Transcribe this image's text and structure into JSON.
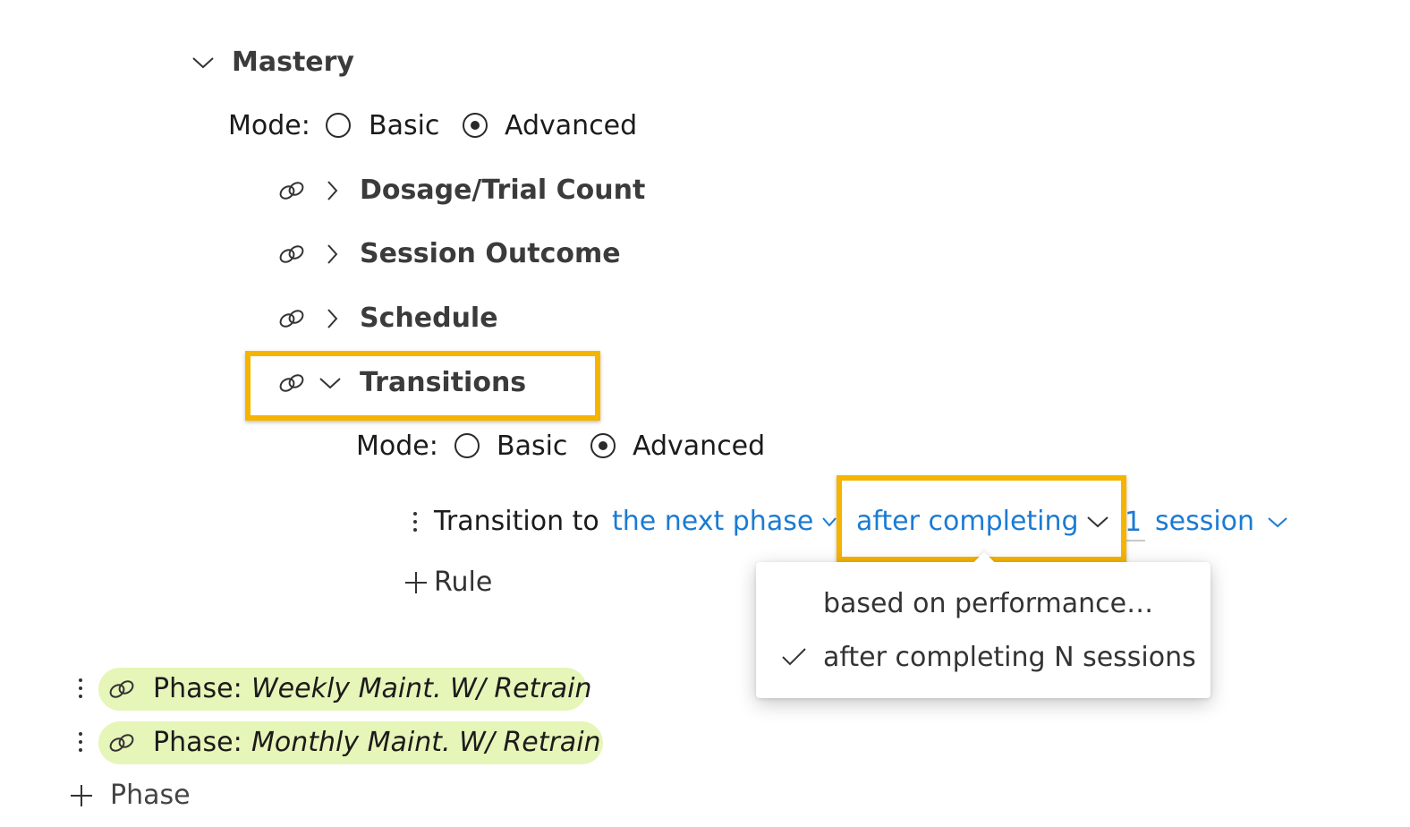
{
  "mastery": {
    "title": "Mastery"
  },
  "mode_top": {
    "label": "Mode:",
    "option_basic": "Basic",
    "option_advanced": "Advanced",
    "selected": "Advanced"
  },
  "sections": [
    {
      "label": "Dosage/Trial Count",
      "expanded": false
    },
    {
      "label": "Session Outcome",
      "expanded": false
    },
    {
      "label": "Schedule",
      "expanded": false
    },
    {
      "label": "Transitions",
      "expanded": true
    }
  ],
  "transitions": {
    "mode": {
      "label": "Mode:",
      "option_basic": "Basic",
      "option_advanced": "Advanced",
      "selected": "Advanced"
    },
    "rule": {
      "prefix": "Transition to",
      "target": "the next phase",
      "condition": "after completing",
      "count": "1",
      "unit": "session"
    },
    "add_rule": "Rule"
  },
  "dropdown": {
    "items": [
      {
        "label": "based on performance…",
        "checked": false
      },
      {
        "label": "after completing N sessions",
        "checked": true
      }
    ]
  },
  "phases": [
    {
      "prefix": "Phase:",
      "name": "Weekly Maint. W/ Retrain"
    },
    {
      "prefix": "Phase:",
      "name": "Monthly Maint. W/ Retrain"
    }
  ],
  "add_phase": "Phase",
  "colors": {
    "link": "#1b7bd3",
    "highlight": "#f5b400",
    "chip": "#e6f5b8"
  }
}
